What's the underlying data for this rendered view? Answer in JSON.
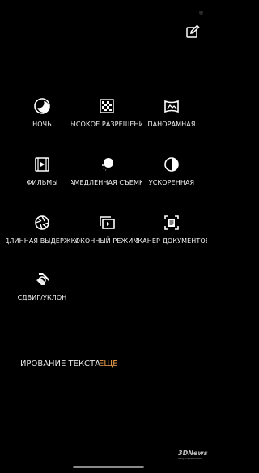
{
  "modes": [
    {
      "label": "НОЧЬ",
      "icon": "night-moon-icon"
    },
    {
      "label": "ВЫСОКОЕ РАЗРЕШЕНИЕ",
      "icon": "high-resolution-icon"
    },
    {
      "label": "ПАНОРАМНАЯ",
      "icon": "panorama-icon"
    },
    {
      "label": "ФИЛЬМЫ",
      "icon": "movie-film-icon"
    },
    {
      "label": "ЗАМЕДЛЕННАЯ СЪЕМКА",
      "icon": "slow-motion-icon"
    },
    {
      "label": "УСКОРЕННАЯ",
      "icon": "time-lapse-icon"
    },
    {
      "label": "ДЛИННАЯ ВЫДЕРЖКА",
      "icon": "long-exposure-icon"
    },
    {
      "label": "ОКОННЫЙ РЕЖИМ",
      "icon": "dual-window-icon"
    },
    {
      "label": "СКАНЕР ДОКУМЕНТОВ",
      "icon": "document-scanner-icon"
    },
    {
      "label": "СДВИГ/УКЛОН",
      "icon": "tilt-shift-icon"
    }
  ],
  "bottom": {
    "scan_label": "ИРОВАНИЕ ТЕКСТА",
    "more_label": "ЕЩЕ"
  },
  "colors": {
    "accent": "#f0a24b",
    "background": "#000000"
  },
  "watermark": {
    "brand": "3DNews",
    "tagline": "Daily Digital Digest"
  }
}
